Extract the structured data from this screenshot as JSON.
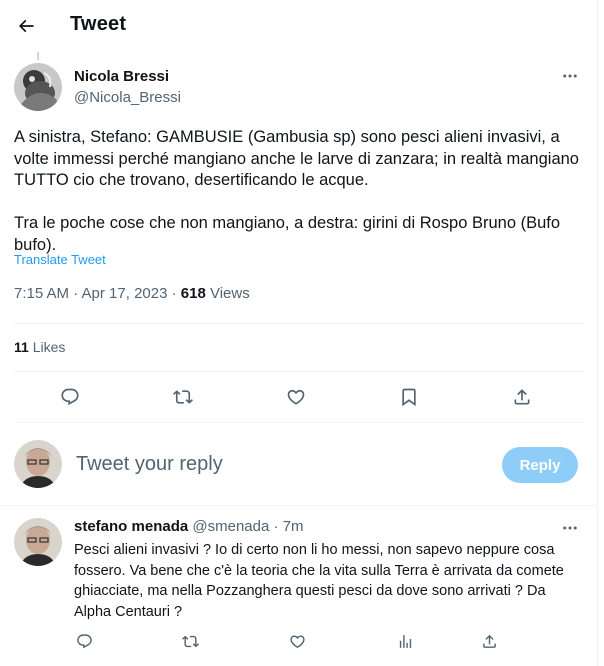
{
  "header": {
    "title": "Tweet"
  },
  "tweet": {
    "author_name": "Nicola Bressi",
    "author_handle": "@Nicola_Bressi",
    "text": "A sinistra, Stefano: GAMBUSIE (Gambusia sp) sono pesci alieni invasivi, a volte immessi perché mangiano anche le larve di zanzara; in realtà mangiano TUTTO cio che trovano, desertificando le acque.\n\nTra le poche cose che non mangiano, a destra: girini di Rospo Bruno (Bufo bufo).",
    "translate_label": "Translate Tweet",
    "timestamp": "7:15 AM · Apr 17, 2023 · ",
    "views_count": "618",
    "views_label": " Views",
    "likes_count": "11",
    "likes_label": " Likes"
  },
  "composer": {
    "placeholder": "Tweet your reply",
    "reply_button": "Reply"
  },
  "reply": {
    "author_name": "stefano menada",
    "author_handle": "@smenada",
    "time": " · 7m",
    "text": "Pesci alieni invasivi ? Io di certo non li ho messi, non sapevo neppure cosa fossero. Va bene che c'è la teoria che la vita sulla Terra è arrivata da comete ghiacciate, ma nella Pozzanghera questi pesci da dove sono arrivati ? Da Alpha Centauri ?"
  },
  "icons": {
    "back": "arrow-left-icon",
    "more": "more-dots-icon",
    "reply": "comment-icon",
    "retweet": "retweet-icon",
    "like": "heart-icon",
    "bookmark": "bookmark-icon",
    "share": "share-icon",
    "analytics": "analytics-icon"
  },
  "colors": {
    "accent": "#1d9bf0",
    "reply_button_disabled": "#8ecdf8",
    "secondary_text": "#536471"
  }
}
